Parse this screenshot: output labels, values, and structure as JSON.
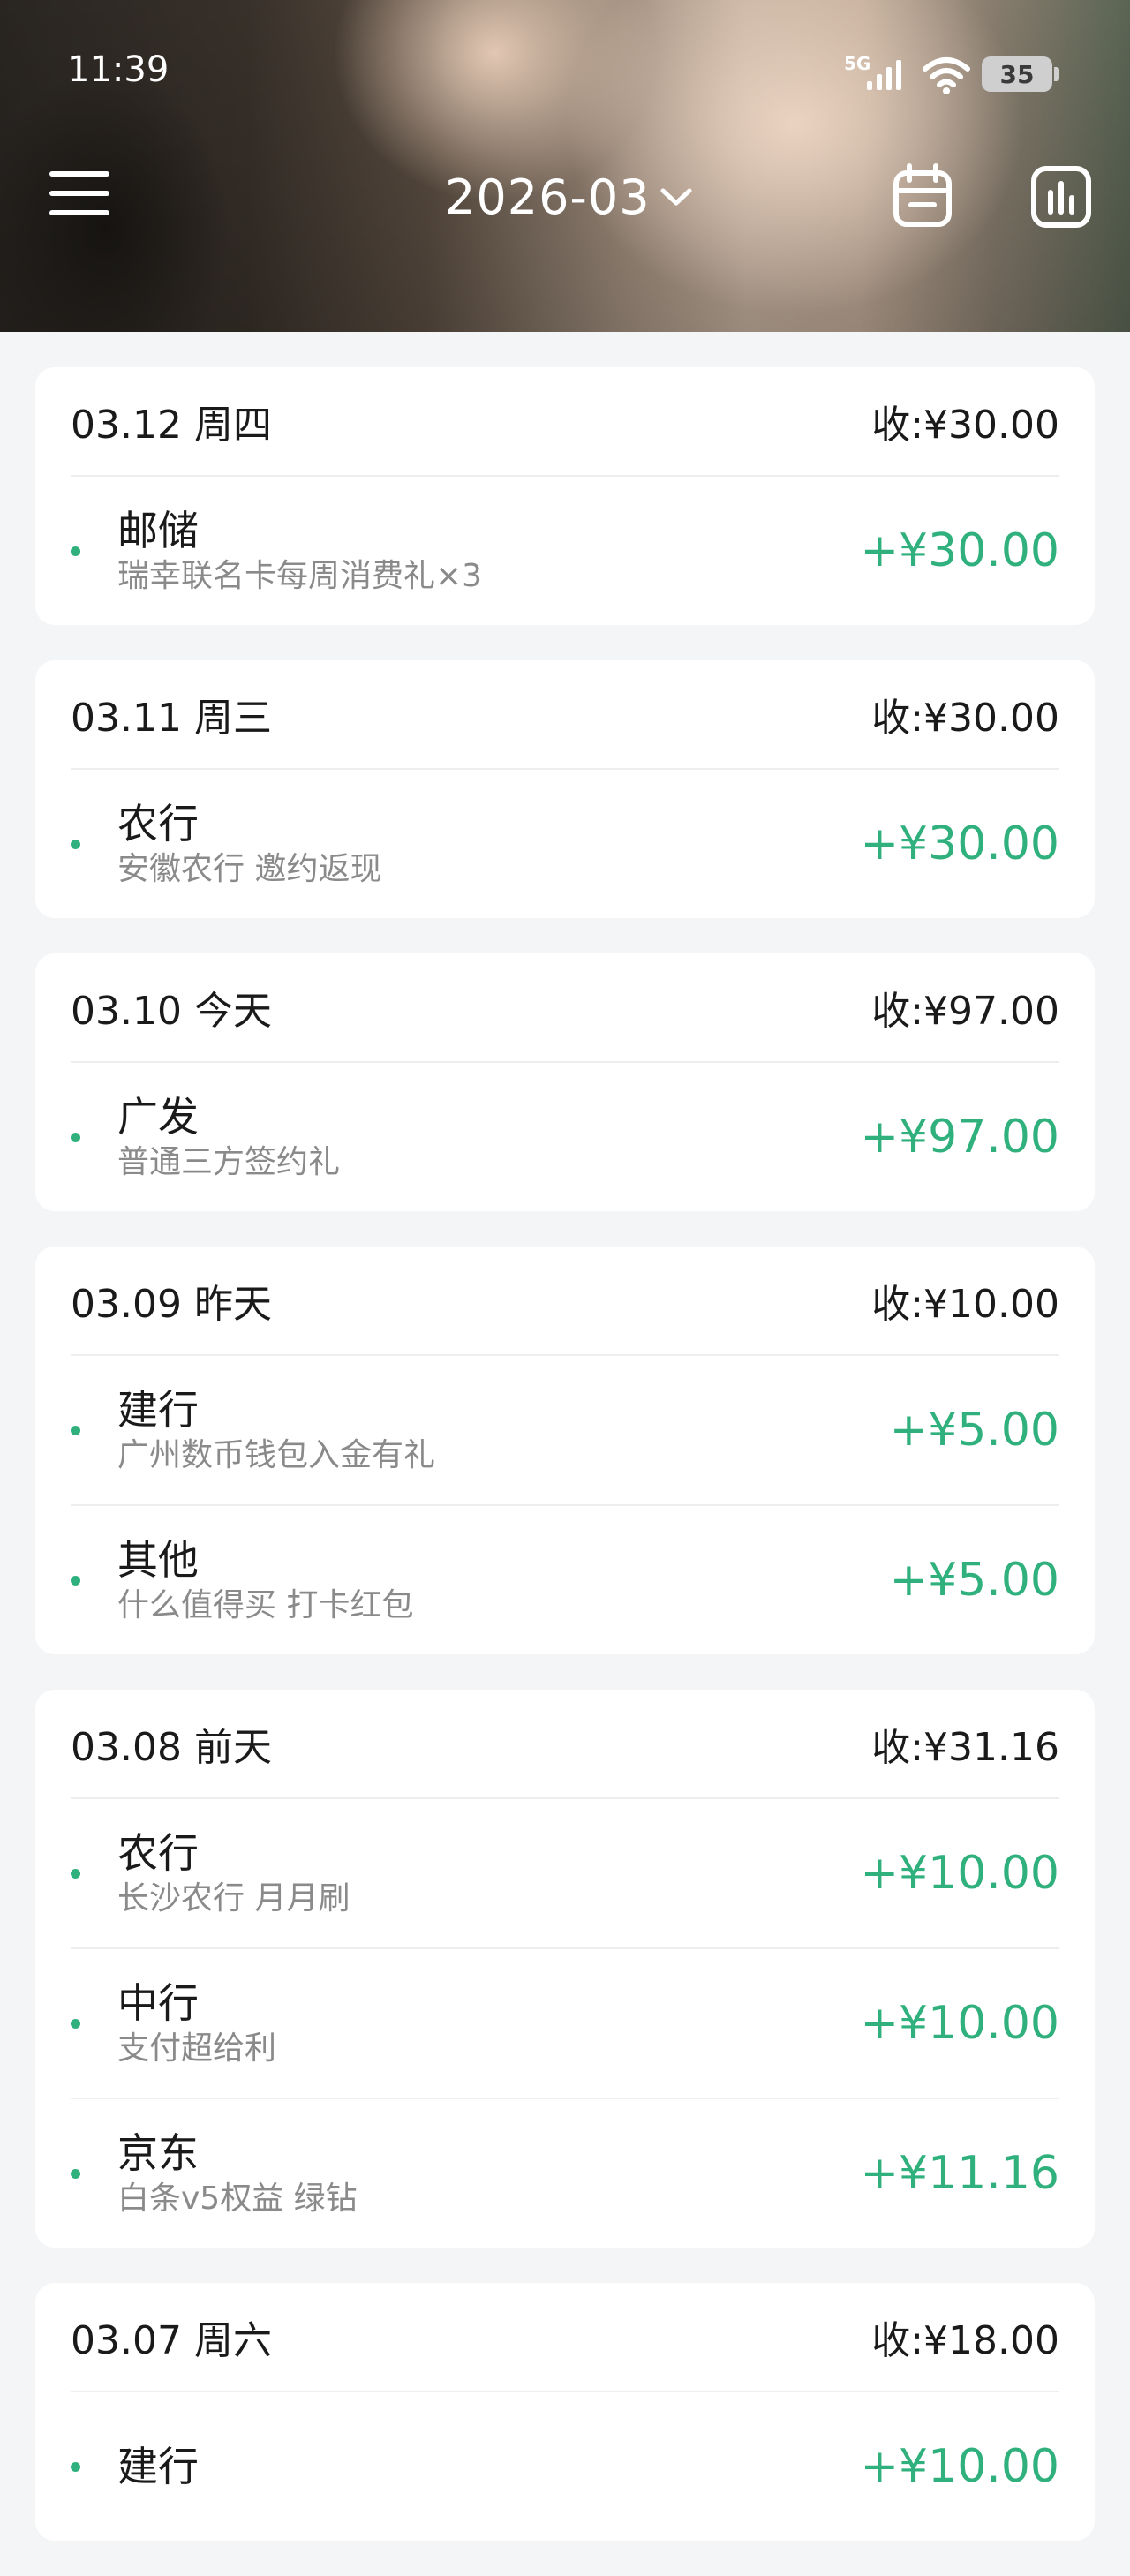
{
  "status_bar": {
    "time": "11:39",
    "network": "5G",
    "battery": "35"
  },
  "header": {
    "month": "2026-03",
    "icons": [
      "menu-icon",
      "chevron-down-icon",
      "calendar-icon",
      "bar-chart-icon"
    ]
  },
  "colors": {
    "income_green": "#2fb07c",
    "card_bg": "#ffffff",
    "page_bg": "#f4f5f7"
  },
  "days": [
    {
      "date": "03.12 周四",
      "total": "收:¥30.00",
      "items": [
        {
          "title": "邮储",
          "note": "瑞幸联名卡每周消费礼×3",
          "amount": "+¥30.00"
        }
      ]
    },
    {
      "date": "03.11 周三",
      "total": "收:¥30.00",
      "items": [
        {
          "title": "农行",
          "note": "安徽农行 邀约返现",
          "amount": "+¥30.00"
        }
      ]
    },
    {
      "date": "03.10 今天",
      "total": "收:¥97.00",
      "items": [
        {
          "title": "广发",
          "note": "普通三方签约礼",
          "amount": "+¥97.00"
        }
      ]
    },
    {
      "date": "03.09 昨天",
      "total": "收:¥10.00",
      "items": [
        {
          "title": "建行",
          "note": "广州数币钱包入金有礼",
          "amount": "+¥5.00"
        },
        {
          "title": "其他",
          "note": "什么值得买 打卡红包",
          "amount": "+¥5.00"
        }
      ]
    },
    {
      "date": "03.08 前天",
      "total": "收:¥31.16",
      "items": [
        {
          "title": "农行",
          "note": "长沙农行 月月刷",
          "amount": "+¥10.00"
        },
        {
          "title": "中行",
          "note": "支付超给利",
          "amount": "+¥10.00"
        },
        {
          "title": "京东",
          "note": "白条v5权益 绿钻",
          "amount": "+¥11.16"
        }
      ]
    },
    {
      "date": "03.07 周六",
      "total": "收:¥18.00",
      "items": [
        {
          "title": "建行",
          "note": "",
          "amount": "+¥10.00"
        }
      ]
    }
  ]
}
